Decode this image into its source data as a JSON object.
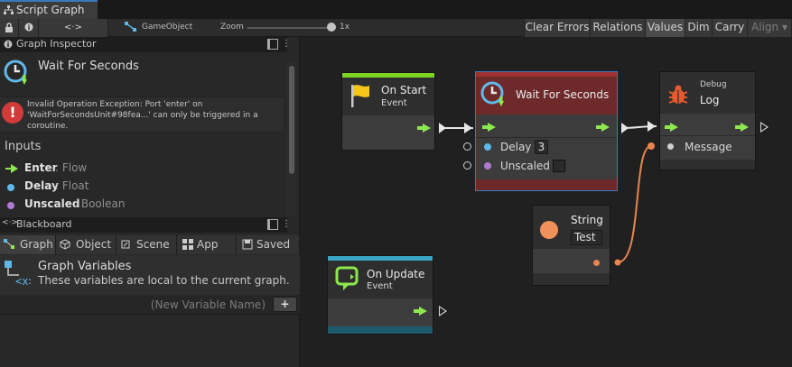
{
  "window": {
    "tab_title": "Script Graph"
  },
  "toolbar": {
    "lock_icon": "lock-icon",
    "info_icon": "info-icon",
    "code_toggle": "<·>",
    "breadcrumb": "GameObject",
    "zoom_label": "Zoom",
    "zoom_value": "1x",
    "zoom_level": 1.0,
    "buttons": [
      "Clear Errors",
      "Relations",
      "Values",
      "Dim",
      "Carry",
      "Align ▾"
    ]
  },
  "inspector": {
    "header": "Graph Inspector",
    "node_title": "Wait For Seconds",
    "error": "Invalid Operation Exception: Port 'enter' on 'WaitForSecondsUnit#98fea...' can only be triggered in a coroutine.",
    "inputs_label": "Inputs",
    "inputs": [
      {
        "name": "Enter",
        "type": " : Flow",
        "color": "#8de84f"
      },
      {
        "name": "Delay",
        "type": " : Float",
        "color": "#5fb8e8"
      },
      {
        "name": "Unscaled",
        "type": " : Boolean",
        "color": "#b07ad0"
      }
    ]
  },
  "blackboard": {
    "header": "Blackboard",
    "tabs": [
      "Graph",
      "Object",
      "Scene",
      "App",
      "Saved"
    ],
    "section_title": "Graph Variables",
    "section_desc": "These variables are local to the current graph.",
    "new_var_placeholder": "(New Variable Name)",
    "add_label": "+"
  },
  "nodes": {
    "on_start": {
      "title": "On Start",
      "subtitle": "Event",
      "color": "#7ed321"
    },
    "wait": {
      "title": "Wait For Seconds",
      "delay_label": "Delay",
      "delay_value": "3",
      "unscaled_label": "Unscaled",
      "unscaled_checked": false,
      "color": "#8e2e2e"
    },
    "debug": {
      "category": "Debug",
      "title": "Log",
      "message_label": "Message"
    },
    "string": {
      "title": "String",
      "value": "Test"
    },
    "on_update": {
      "title": "On Update",
      "subtitle": "Event",
      "color": "#3aa6c6"
    }
  }
}
